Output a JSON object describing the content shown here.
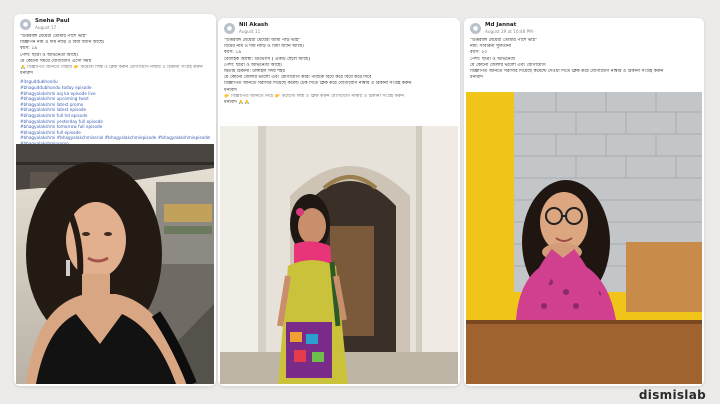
{
  "posts": [
    {
      "author": "Sneha Paul",
      "date": "August 17 · ",
      "lines": [
        "\"উত্তরবঙ্গ মেয়েরা তোমার পাশে ভাই\"",
        "বিজ্ঞাপন নাম ও দাম নাড়ি ও বিধা জানি আছে।",
        "বয়স: ১৯",
        "পেশা: ছাত্রী ও অভিনেত্রী আছে।",
        "যে কোনো সময়ে যোগাযোগ এসো সময়",
        "🙏 বিজ্ঞাপিত জানতে বিস্তার 👉 কমেন্টে লিঙ্ক ও ক্লিক করুন যোগাযোগ নাম্বার ও ঠিকানা সংগ্রহ করুন",
        "ধন্যবাদ"
      ],
      "hashtags": [
        "#itsguddubhondu",
        "#bhaguddubhondu today episode",
        "#bhagyalakshmi aaj ka episode live",
        "#bhagyalakshmi upcoming twist",
        "#bhagyalakshmi latest promo",
        "#bhagyalakshmi latest episode",
        "#bhagyalakshmi full hd episode",
        "#bhagyalakshmi yesterday full episode",
        "#bhagyalakshmi tomorrow full episode",
        "#bhagyalakshmi full episode"
      ],
      "hashtag_row_1": "#bhagyalakshmi #bhagyalakshmiserial #bhagyalakshmiepisode #bhagyalakshmiepisodetoday",
      "hashtag_row_2": "#bhagyalakshmipromo"
    },
    {
      "author": "Nil Akash",
      "date": "August 11 · ",
      "lines": [
        "\"উত্তরবঙ্গ মেয়েরা মেয়েরা জামা পাড় ভাই\"",
        "বিয়ের নাম ও দাম নাড়ি ও বিধা জানি আছে।",
        "বয়স: ১৯",
        "বৈবাহিক অবস্থা: ডিভোর্সি ( একটি ছেলে আছে)",
        "পেশা: ছাত্রী ও অভিনেত্রী আছে।",
        "দ্বিতীয় ঠিকানা: টাঙ্গাইল সদর শহর",
        "যে কোনো জেলার ভালো এবং যোগাযোগ কারী পাত্রকে বিয়ে করে বিয়ে করে দিবে",
        "বিজ্ঞাপিত জানতে সরাসরি দিয়েছে কমেন্ট চেক দিতে ক্লিক করে যোগাযোগ নাম্বার ও ঠিকানা সংগ্রহ করুন",
        "ধন্যবাদ",
        "👉 বিজ্ঞাপিত জানতে নিচে 👉 কমেন্টে লিঙ্ক ও ক্লিক করুন যোগাযোগ নাম্বার ও ঠিকানা সংগ্রহ করুন",
        "ধন্যবাদ 🙏🙏"
      ]
    },
    {
      "author": "Md Jannat",
      "date": "August 29 at 10:48 PM · ",
      "lines": [
        "\"উত্তরবঙ্গ মেয়েরা তোমার পাশে ভাই\"",
        "নাম: সাবরিনা সুলতানা",
        "বয়স: ২০",
        "পেশা: ছাত্রী ও অভিনেত্রী",
        "যে কোনো জেলার ভালো এবং যোগাযোগ",
        "বিজ্ঞাপিত জানতে সরাসরি দিয়েছে কমেন্টে দেওয়া দিতে ক্লিক করে যোগাযোগ নাম্বার ও ঠিকানা সংগ্রহ করুন",
        "ধন্যবাদ"
      ]
    }
  ],
  "brand": "dismislab"
}
